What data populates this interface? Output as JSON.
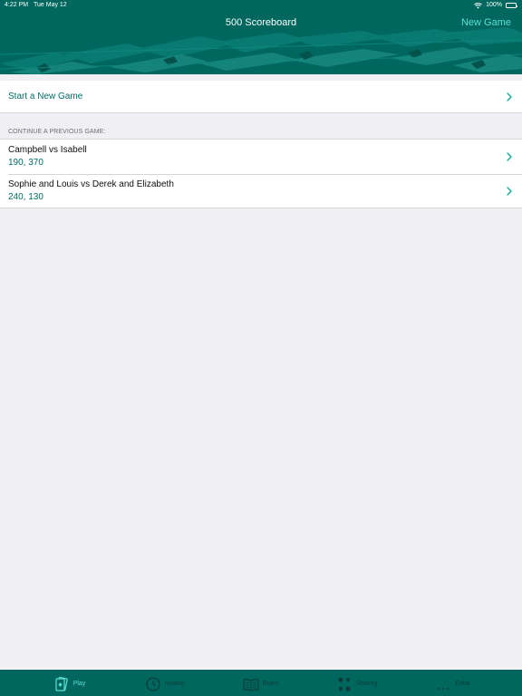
{
  "status_bar": {
    "time": "4:22 PM",
    "date": "Tue May 12",
    "battery": "100%"
  },
  "nav": {
    "title": "500 Scoreboard",
    "action": "New Game"
  },
  "start_row": {
    "label": "Start a New Game"
  },
  "section": {
    "header": "CONTINUE A PREVIOUS GAME:"
  },
  "games": [
    {
      "title": "Campbell vs Isabell",
      "score": "190, 370"
    },
    {
      "title": "Sophie and Louis vs Derek and Elizabeth",
      "score": "240, 130"
    }
  ],
  "tabs": [
    {
      "label": "Play",
      "icon": "play-card-icon",
      "active": true
    },
    {
      "label": "History",
      "icon": "history-clock-icon",
      "active": false
    },
    {
      "label": "Rules",
      "icon": "rules-book-icon",
      "active": false
    },
    {
      "label": "Scoring",
      "icon": "scoring-suits-icon",
      "active": false
    },
    {
      "label": "Extra",
      "icon": "more-dots-icon",
      "active": false
    }
  ],
  "colors": {
    "brand_teal": "#00675f",
    "accent": "#5ee0d5",
    "link_teal": "#006d65",
    "background": "#efeff4"
  }
}
